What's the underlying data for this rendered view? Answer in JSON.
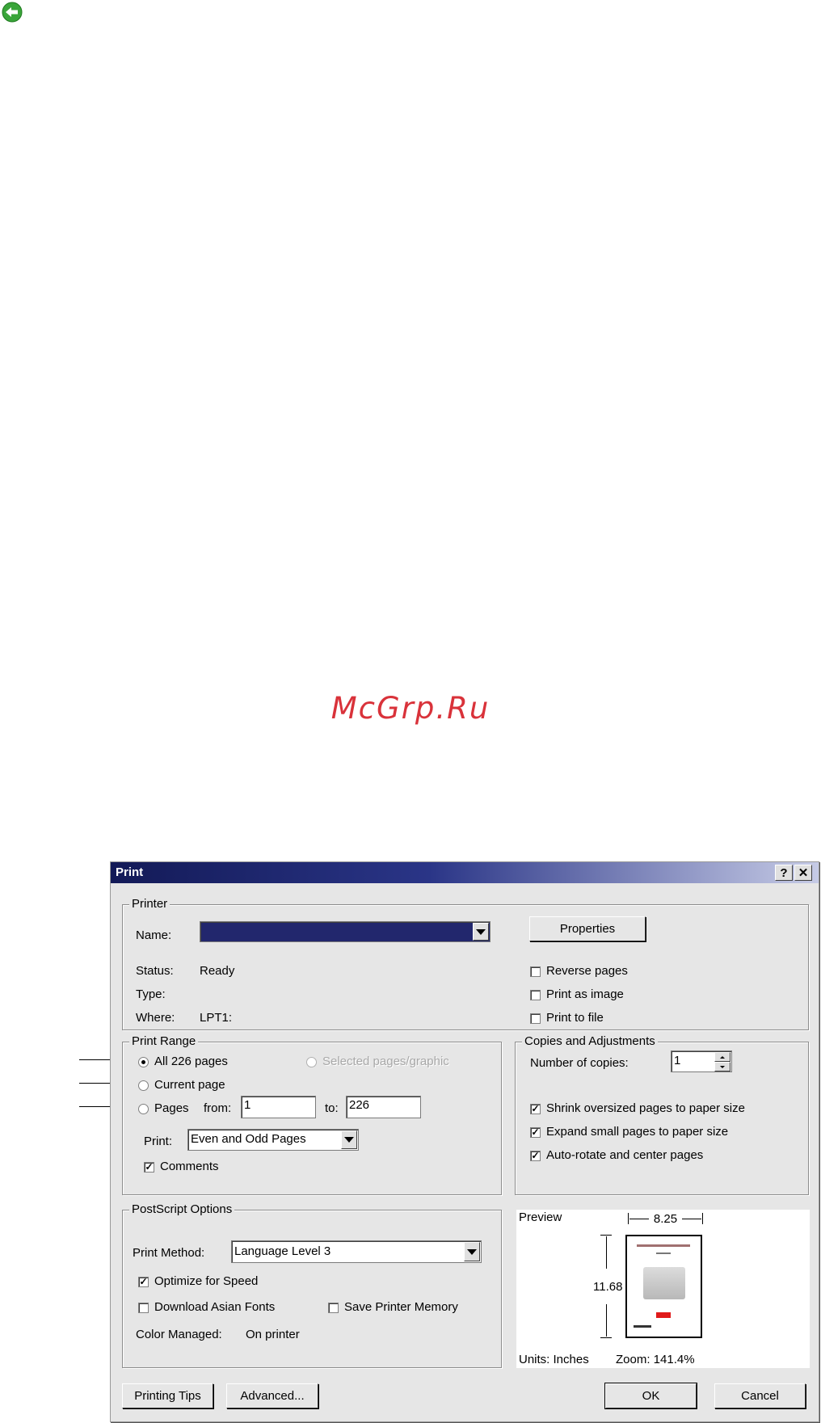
{
  "watermark": "McGrp.Ru",
  "dialog": {
    "title": "Print",
    "help_label": "?",
    "close_label": "✕"
  },
  "printer": {
    "legend": "Printer",
    "name_label": "Name:",
    "name_value": "",
    "properties_label": "Properties",
    "status_label": "Status:",
    "status_value": "Ready",
    "type_label": "Type:",
    "type_value": "",
    "where_label": "Where:",
    "where_value": "LPT1:",
    "reverse_pages": "Reverse pages",
    "print_as_image": "Print as image",
    "print_to_file": "Print to file"
  },
  "print_range": {
    "legend": "Print Range",
    "all_pages": "All 226 pages",
    "selected": "Selected pages/graphic",
    "current_page": "Current page",
    "pages": "Pages",
    "from_label": "from:",
    "from_value": "1",
    "to_label": "to:",
    "to_value": "226",
    "print_label": "Print:",
    "print_value": "Even and Odd Pages",
    "comments": "Comments"
  },
  "copies": {
    "legend": "Copies and Adjustments",
    "number_label": "Number of copies:",
    "number_value": "1",
    "shrink": "Shrink oversized pages to paper size",
    "expand": "Expand small pages to paper size",
    "autorotate": "Auto-rotate and center pages"
  },
  "postscript": {
    "legend": "PostScript Options",
    "method_label": "Print Method:",
    "method_value": "Language Level 3",
    "optimize": "Optimize for Speed",
    "download_fonts": "Download Asian Fonts",
    "save_memory": "Save Printer Memory",
    "color_label": "Color Managed:",
    "color_value": "On printer"
  },
  "preview": {
    "label": "Preview",
    "width": "8.25",
    "height": "11.68",
    "units": "Units: Inches",
    "zoom": "Zoom: 141.4%"
  },
  "buttons": {
    "printing_tips": "Printing Tips",
    "advanced": "Advanced...",
    "ok": "OK",
    "cancel": "Cancel"
  },
  "colors": {
    "title_bar": "#131a57",
    "dialog_bg": "#e6e6e6",
    "watermark": "#d9323a",
    "back_icon": "#3aa53a"
  },
  "icons": [
    "back-arrow-icon",
    "help-icon",
    "close-icon",
    "dropdown-arrow-icon",
    "spinner-up-icon",
    "spinner-down-icon"
  ]
}
